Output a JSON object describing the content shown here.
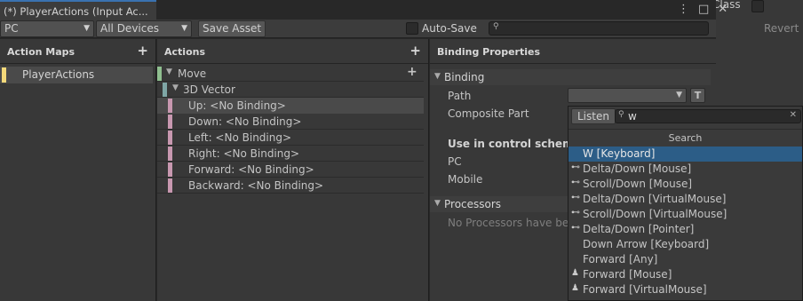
{
  "window": {
    "tab_title": "(*) PlayerActions (Input Ac...",
    "menu_icon": "kebab-icon",
    "max_icon": "maximize-icon",
    "close_icon": "close-icon"
  },
  "background": {
    "class_label": "Class",
    "revert_label": "Revert"
  },
  "toolbar": {
    "scheme_value": "PC",
    "devices_value": "All Devices",
    "save_asset_label": "Save Asset",
    "auto_save_label": "Auto-Save",
    "search_value": ""
  },
  "action_maps": {
    "header": "Action Maps",
    "items": [
      {
        "label": "PlayerActions",
        "color": "#f4d97a"
      }
    ]
  },
  "actions": {
    "header": "Actions",
    "move_label": "Move",
    "composite_label": "3D Vector",
    "bindings": [
      {
        "label": "Up: <No Binding>"
      },
      {
        "label": "Down: <No Binding>"
      },
      {
        "label": "Left: <No Binding>"
      },
      {
        "label": "Right: <No Binding>"
      },
      {
        "label": "Forward: <No Binding>"
      },
      {
        "label": "Backward: <No Binding>"
      }
    ],
    "colors": {
      "action": "#8fbf8f",
      "composite": "#7fa6a6",
      "binding": "#c898b0"
    }
  },
  "binding_properties": {
    "header": "Binding Properties",
    "binding_section": "Binding",
    "path_label": "Path",
    "path_value": "",
    "t_button": "T",
    "composite_part_label": "Composite Part",
    "use_in_scheme": "Use in control scheme",
    "schemes": [
      "PC",
      "Mobile"
    ],
    "processors_section": "Processors",
    "no_processors": "No Processors have bee"
  },
  "popup": {
    "listen_label": "Listen",
    "search_value": "w",
    "section_label": "Search",
    "items": [
      {
        "label": "W [Keyboard]",
        "icon": "",
        "selected": true
      },
      {
        "label": "Delta/Down [Mouse]",
        "icon": "axis-icon"
      },
      {
        "label": "Scroll/Down [Mouse]",
        "icon": "axis-icon"
      },
      {
        "label": "Delta/Down [VirtualMouse]",
        "icon": "axis-icon"
      },
      {
        "label": "Scroll/Down [VirtualMouse]",
        "icon": "axis-icon"
      },
      {
        "label": "Delta/Down [Pointer]",
        "icon": "axis-icon"
      },
      {
        "label": "Down Arrow [Keyboard]",
        "icon": ""
      },
      {
        "label": "Forward [Any]",
        "icon": ""
      },
      {
        "label": "Forward [Mouse]",
        "icon": "person-icon"
      },
      {
        "label": "Forward [VirtualMouse]",
        "icon": "person-icon"
      }
    ]
  },
  "colors": {
    "accent": "#2c5d87",
    "panel": "#383838",
    "background": "#282828"
  }
}
